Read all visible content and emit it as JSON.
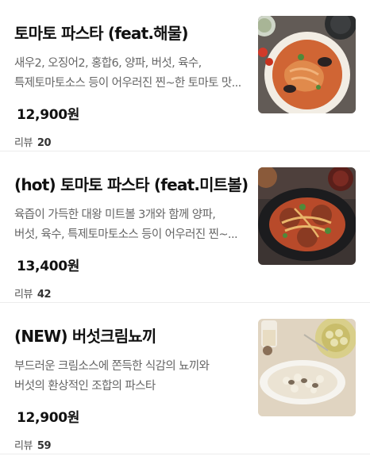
{
  "menu": {
    "items": [
      {
        "title": "토마토 파스타 (feat.해물)",
        "desc_line1": "새우2, 오징어2, 홍합6, 양파, 버섯, 육수,",
        "desc_line2": "특제토마토소스 등이 어우러진 찐~한 토마토 맛...",
        "price": "12,900원",
        "review_label": "리뷰",
        "review_count": "20",
        "image_icon": "seafood-tomato-pasta-photo"
      },
      {
        "title": "(hot) 토마토 파스타 (feat.미트볼)",
        "desc_line1": "육즙이 가득한 대왕 미트볼 3개와 함께 양파,",
        "desc_line2": "버섯, 육수, 특제토마토소스 등이 어우러진 찐~...",
        "price": "13,400원",
        "review_label": "리뷰",
        "review_count": "42",
        "image_icon": "meatball-tomato-pasta-photo"
      },
      {
        "title": "(NEW) 버섯크림뇨끼",
        "desc_line1": "부드러운 크림소스에 쫀득한 식감의 뇨끼와",
        "desc_line2": "버섯의 환상적인 조합의 파스타",
        "price": "12,900원",
        "review_label": "리뷰",
        "review_count": "59",
        "image_icon": "mushroom-cream-gnocchi-photo"
      }
    ]
  }
}
